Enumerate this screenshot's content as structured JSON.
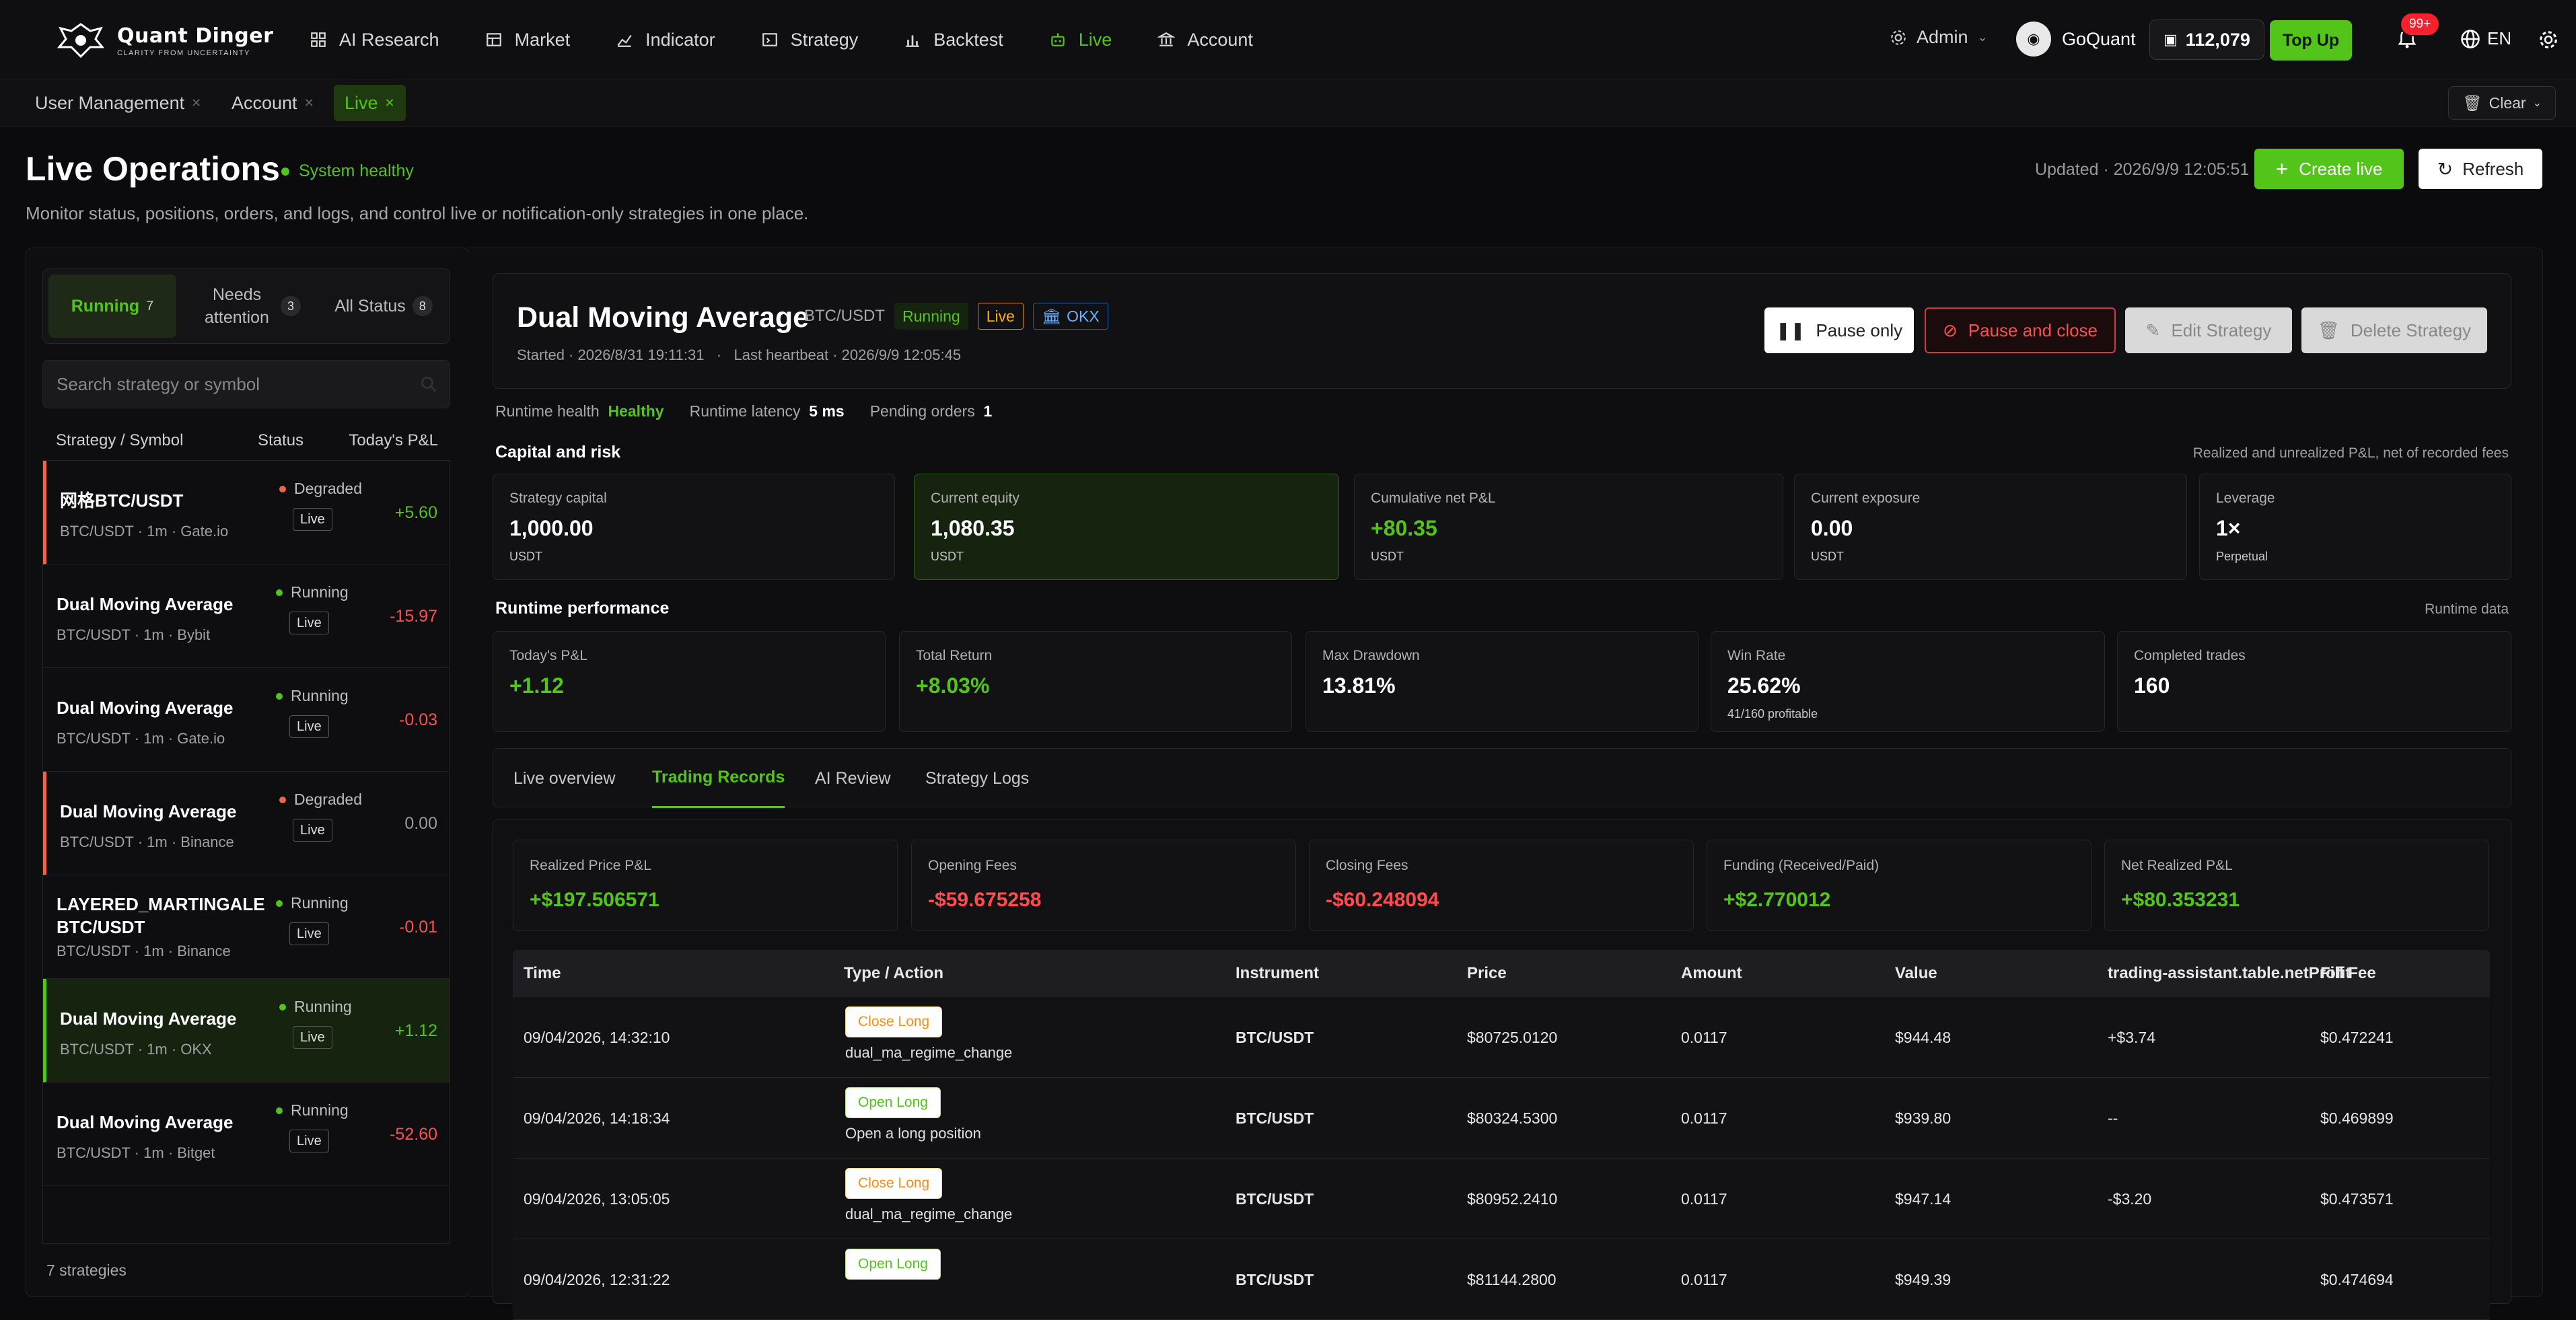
{
  "brand": {
    "name": "Quant Dinger",
    "tagline": "CLARITY FROM UNCERTAINTY"
  },
  "nav": [
    {
      "label": "AI Research",
      "icon": "grid-icon"
    },
    {
      "label": "Market",
      "icon": "table-icon"
    },
    {
      "label": "Indicator",
      "icon": "line-chart-icon"
    },
    {
      "label": "Strategy",
      "icon": "code-icon"
    },
    {
      "label": "Backtest",
      "icon": "bar-chart-icon"
    },
    {
      "label": "Live",
      "icon": "robot-icon",
      "active": true
    },
    {
      "label": "Account",
      "icon": "bank-icon"
    }
  ],
  "topbar": {
    "admin": "Admin",
    "user": "GoQuant",
    "credits": "112,079",
    "topup": "Top Up",
    "notifications": "99+",
    "lang": "EN"
  },
  "tabs": [
    {
      "label": "User Management"
    },
    {
      "label": "Account"
    },
    {
      "label": "Live",
      "active": true
    }
  ],
  "clear_label": "Clear",
  "page": {
    "title": "Live Operations",
    "health": "System healthy",
    "subtitle": "Monitor status, positions, orders, and logs, and control live or notification-only strategies in one place.",
    "updated": "Updated · 2026/9/9 12:05:51",
    "create": "Create live",
    "refresh": "Refresh"
  },
  "filters": [
    {
      "label": "Running",
      "count": "7"
    },
    {
      "label": "Needs attention",
      "count": "3"
    },
    {
      "label": "All Status",
      "count": "8"
    }
  ],
  "search_placeholder": "Search strategy or symbol",
  "list_headers": {
    "name": "Strategy / Symbol",
    "status": "Status",
    "pnl": "Today's P&L"
  },
  "strategies": [
    {
      "name": "网格BTC/USDT",
      "sub": "BTC/USDT · 1m · Gate.io",
      "status": "Degraded",
      "mode": "Live",
      "pnl": "+5.60",
      "tone": "pos",
      "state": "warn"
    },
    {
      "name": "Dual Moving Average",
      "sub": "BTC/USDT · 1m · Bybit",
      "status": "Running",
      "mode": "Live",
      "pnl": "-15.97",
      "tone": "neg",
      "state": ""
    },
    {
      "name": "Dual Moving Average",
      "sub": "BTC/USDT · 1m · Gate.io",
      "status": "Running",
      "mode": "Live",
      "pnl": "-0.03",
      "tone": "neg",
      "state": ""
    },
    {
      "name": "Dual Moving Average",
      "sub": "BTC/USDT · 1m · Binance",
      "status": "Degraded",
      "mode": "Live",
      "pnl": "0.00",
      "tone": "zero",
      "state": "warn"
    },
    {
      "name": "LAYERED_MARTINGALE BTC/USDT",
      "sub": "BTC/USDT · 1m · Binance",
      "status": "Running",
      "mode": "Live",
      "pnl": "-0.01",
      "tone": "neg",
      "state": ""
    },
    {
      "name": "Dual Moving Average",
      "sub": "BTC/USDT · 1m · OKX",
      "status": "Running",
      "mode": "Live",
      "pnl": "+1.12",
      "tone": "pos",
      "state": "sel"
    },
    {
      "name": "Dual Moving Average",
      "sub": "BTC/USDT · 1m · Bitget",
      "status": "Running",
      "mode": "Live",
      "pnl": "-52.60",
      "tone": "neg",
      "state": ""
    }
  ],
  "list_footer": "7 strategies",
  "detail": {
    "name": "Dual Moving Average",
    "symbol": "BTC/USDT",
    "status": "Running",
    "mode": "Live",
    "exchange": "OKX",
    "meta": "Started · 2026/8/31 19:11:31   ·   Last heartbeat · 2026/9/9 12:05:45",
    "buttons": {
      "pause": "Pause only",
      "pause_close": "Pause and close",
      "edit": "Edit Strategy",
      "delete": "Delete Strategy"
    },
    "runtime": {
      "health_label": "Runtime health",
      "health": "Healthy",
      "latency_label": "Runtime latency",
      "latency": "5 ms",
      "pending_label": "Pending orders",
      "pending": "1"
    }
  },
  "capital": {
    "title": "Capital and risk",
    "hint": "Realized and unrealized P&L, net of recorded fees",
    "cards": [
      {
        "label": "Strategy capital",
        "value": "1,000.00",
        "unit": "USDT"
      },
      {
        "label": "Current equity",
        "value": "1,080.35",
        "unit": "USDT"
      },
      {
        "label": "Cumulative net P&L",
        "value": "+80.35",
        "unit": "USDT"
      },
      {
        "label": "Current exposure",
        "value": "0.00",
        "unit": "USDT"
      },
      {
        "label": "Leverage",
        "value": "1×",
        "unit": "Perpetual"
      }
    ]
  },
  "performance": {
    "title": "Runtime performance",
    "hint": "Runtime data",
    "cards": [
      {
        "label": "Today's P&L",
        "value": "+1.12",
        "unit": ""
      },
      {
        "label": "Total Return",
        "value": "+8.03%",
        "unit": ""
      },
      {
        "label": "Max Drawdown",
        "value": "13.81%",
        "unit": ""
      },
      {
        "label": "Win Rate",
        "value": "25.62%",
        "unit": "41/160 profitable"
      },
      {
        "label": "Completed trades",
        "value": "160",
        "unit": ""
      }
    ]
  },
  "detail_tabs": [
    "Live overview",
    "Trading Records",
    "AI Review",
    "Strategy Logs"
  ],
  "summary": [
    {
      "label": "Realized Price P&L",
      "value": "+$197.506571"
    },
    {
      "label": "Opening Fees",
      "value": "-$59.675258"
    },
    {
      "label": "Closing Fees",
      "value": "-$60.248094"
    },
    {
      "label": "Funding (Received/Paid)",
      "value": "+$2.770012"
    },
    {
      "label": "Net Realized P&L",
      "value": "+$80.353231"
    }
  ],
  "table": {
    "headers": [
      "Time",
      "Type / Action",
      "Instrument",
      "Price",
      "Amount",
      "Value",
      "trading-assistant.table.netProfit",
      "Fill Fee"
    ],
    "rows": [
      {
        "time": "09/04/2026, 14:32:10",
        "action": "Close Long",
        "desc": "dual_ma_regime_change",
        "instrument": "BTC/USDT",
        "price": "$80725.0120",
        "amount": "0.0117",
        "value": "$944.48",
        "profit": "+$3.74",
        "fee": "$0.472241"
      },
      {
        "time": "09/04/2026, 14:18:34",
        "action": "Open Long",
        "desc": "Open a long position",
        "instrument": "BTC/USDT",
        "price": "$80324.5300",
        "amount": "0.0117",
        "value": "$939.80",
        "profit": "--",
        "fee": "$0.469899"
      },
      {
        "time": "09/04/2026, 13:05:05",
        "action": "Close Long",
        "desc": "dual_ma_regime_change",
        "instrument": "BTC/USDT",
        "price": "$80952.2410",
        "amount": "0.0117",
        "value": "$947.14",
        "profit": "-$3.20",
        "fee": "$0.473571"
      },
      {
        "time": "09/04/2026, 12:31:22",
        "action": "Open Long",
        "desc": "",
        "instrument": "BTC/USDT",
        "price": "$81144.2800",
        "amount": "0.0117",
        "value": "$949.39",
        "profit": "",
        "fee": "$0.474694"
      }
    ]
  },
  "colors": {
    "accent": "#52c41a",
    "danger": "#ff4d4f",
    "warning": "#faad14",
    "bg": "#0b0b0d"
  }
}
